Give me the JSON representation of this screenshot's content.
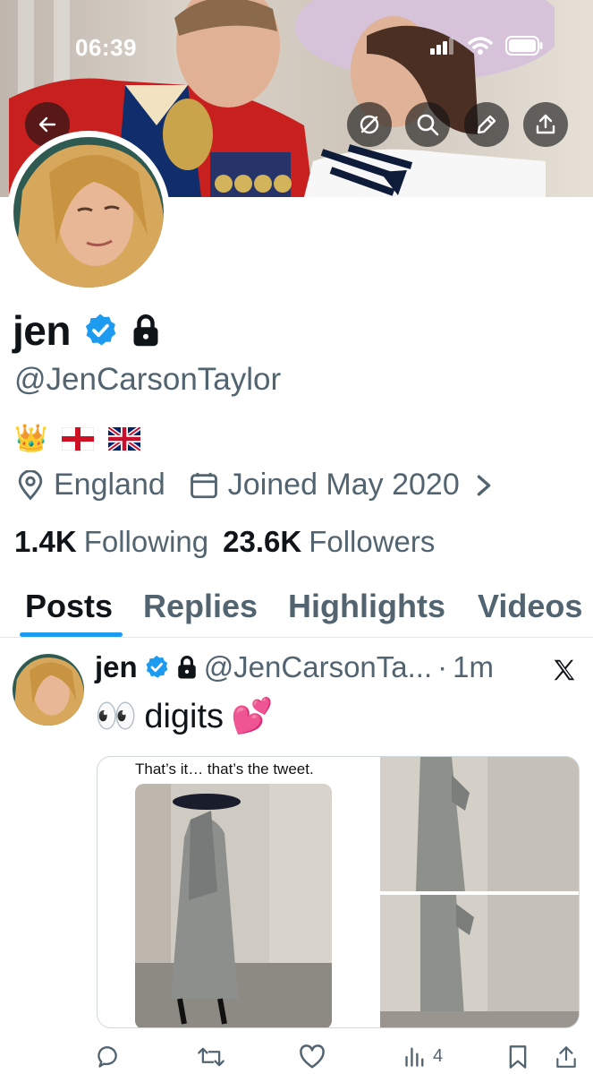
{
  "status_bar": {
    "time": "06:39",
    "icons": [
      "signal-icon",
      "wifi-icon",
      "battery-icon"
    ]
  },
  "header_buttons": [
    "back-arrow-icon",
    "mute-icon",
    "search-icon",
    "edit-icon",
    "share-icon"
  ],
  "profile": {
    "display_name": "jen",
    "handle": "@JenCarsonTaylor",
    "bio_emojis": [
      "👑",
      "🏴",
      "🇬🇧"
    ],
    "location": "England",
    "joined": "Joined May 2020",
    "following_count": "1.4K",
    "following_label": "Following",
    "followers_count": "23.6K",
    "followers_label": "Followers"
  },
  "tabs": [
    {
      "label": "Posts",
      "active": true
    },
    {
      "label": "Replies",
      "active": false
    },
    {
      "label": "Highlights",
      "active": false
    },
    {
      "label": "Videos",
      "active": false
    }
  ],
  "tweet": {
    "name": "jen",
    "handle": "@JenCarsonTa...",
    "separator": "·",
    "time": "1m",
    "emoji_lead": "👀",
    "text": "digits",
    "emoji_trail": "💕",
    "media_caption": "That’s it… that’s the tweet.",
    "views": "4"
  },
  "colors": {
    "verified_blue": "#1d9bf0",
    "secondary_text": "#536471",
    "primary_text": "#0f1419"
  }
}
